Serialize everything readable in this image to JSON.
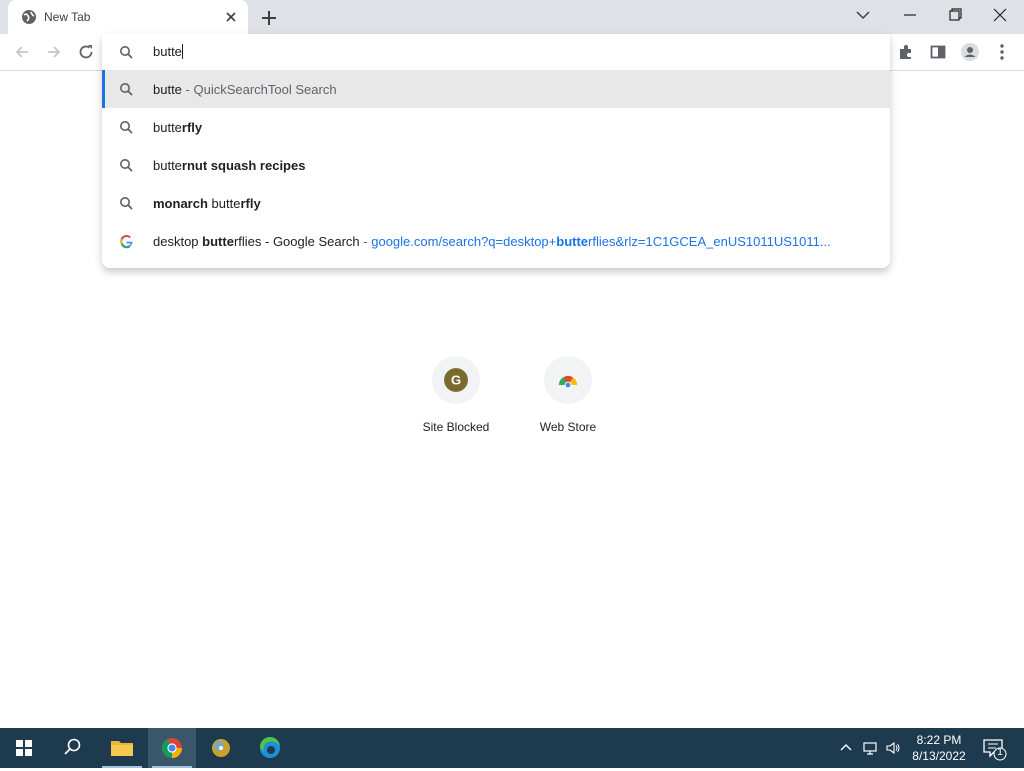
{
  "tab": {
    "title": "New Tab"
  },
  "omnibox": {
    "query": "butte",
    "suggestions": [
      {
        "type": "search",
        "pre": "butte",
        "bold": "",
        "post": "",
        "sep": " - ",
        "desc": "QuickSearchTool Search"
      },
      {
        "type": "search",
        "pre": "butte",
        "bold": "rfly",
        "post": ""
      },
      {
        "type": "search",
        "pre": "butte",
        "bold": "rnut squash recipes",
        "post": ""
      },
      {
        "type": "search",
        "pre_bold": "monarch",
        "pre": " butte",
        "bold": "rfly",
        "post": ""
      },
      {
        "type": "google",
        "pre": "desktop ",
        "bold": "butte",
        "post": "rflies - Google Search",
        "sep": " - ",
        "url_pre": "google.com/search?q=desktop+",
        "url_bold": "butte",
        "url_post": "rflies&rlz=1C1GCEA_enUS1011US1011..."
      }
    ]
  },
  "shortcuts": [
    {
      "label": "Site Blocked",
      "letter": "G",
      "color": "#7a6a2e"
    },
    {
      "label": "Web Store"
    }
  ],
  "taskbar": {
    "time": "8:22 PM",
    "date": "8/13/2022",
    "notifications": "1"
  },
  "colors": {
    "accent": "#1a73e8",
    "taskbar": "#1d3a4f"
  }
}
